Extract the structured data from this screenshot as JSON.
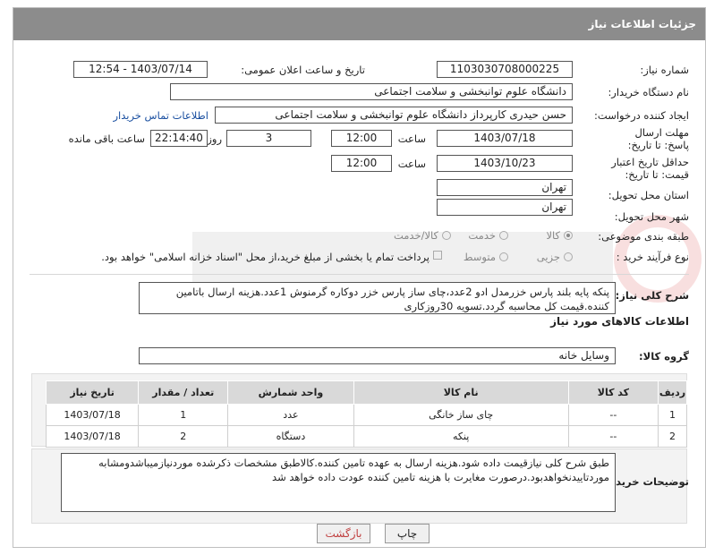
{
  "header": {
    "title": "جزئیات اطلاعات نیاز"
  },
  "need_number": {
    "label": "شماره نیاز:",
    "value": "1103030708000225"
  },
  "announce": {
    "label": "تاریخ و ساعت اعلان عمومی:",
    "value": "1403/07/14 - 12:54"
  },
  "buyer": {
    "label": "نام دستگاه خریدار:",
    "value": "دانشگاه علوم توانبخشی و سلامت اجتماعی"
  },
  "requester": {
    "label": "ایجاد کننده درخواست:",
    "value": "حسن حیدری کارپرداز دانشگاه علوم توانبخشی و سلامت اجتماعی",
    "contact_link": "اطلاعات تماس خریدار"
  },
  "deadline": {
    "label": "مهلت ارسال پاسخ: تا تاریخ:",
    "date": "1403/07/18",
    "time_label": "ساعت",
    "time": "12:00",
    "days": "3",
    "days_label": "روز و",
    "remaining": "22:14:40",
    "remaining_label": "ساعت باقی مانده"
  },
  "validity": {
    "label": "حداقل تاریخ اعتبار قیمت: تا تاریخ:",
    "date": "1403/10/23",
    "time_label": "ساعت",
    "time": "12:00"
  },
  "province": {
    "label": "استان محل تحویل:",
    "value": "تهران"
  },
  "city": {
    "label": "شهر محل تحویل:",
    "value": "تهران"
  },
  "category": {
    "label": "طبقه بندی موضوعی:",
    "options": [
      "کالا",
      "خدمت",
      "کالا/خدمت"
    ]
  },
  "purchase": {
    "label": "نوع فرآیند خرید :",
    "options": [
      "جزیی",
      "متوسط"
    ],
    "treasury_note": "پرداخت تمام یا بخشی از مبلغ خرید،از محل \"اسناد خزانه اسلامی\" خواهد بود."
  },
  "description": {
    "label": "شرح کلی نیاز:",
    "value": "پنکه پایه بلند پارس خزرمدل ادو 2عدد،چای ساز پارس خزر دوکاره گرمنوش 1عدد.هزینه ارسال باتامین کننده.قیمت کل محاسبه گردد.تسویه 30روزکاری"
  },
  "goods_section": {
    "title": "اطلاعات کالاهای مورد نیاز"
  },
  "goods_group": {
    "label": "گروه کالا:",
    "value": "وسایل خانه"
  },
  "table": {
    "headers": [
      "ردیف",
      "کد کالا",
      "نام کالا",
      "واحد شمارش",
      "تعداد / مقدار",
      "تاریخ نیاز"
    ],
    "rows": [
      [
        "1",
        "--",
        "چای ساز خانگی",
        "عدد",
        "1",
        "1403/07/18"
      ],
      [
        "2",
        "--",
        "پنکه",
        "دستگاه",
        "2",
        "1403/07/18"
      ]
    ]
  },
  "buyer_notes": {
    "label": "توضیحات خریدار:",
    "value": "طبق شرح کلی نیازقیمت داده شود.هزینه ارسال به عهده تامین کننده.کالاطبق مشخصات ذکرشده موردنیازمیباشدومشابه موردتاییدنخواهدبود.درصورت مغایرت با هزینه تامین کننده عودت داده خواهد شد"
  },
  "buttons": {
    "print": "چاپ",
    "back": "بازگشت"
  }
}
